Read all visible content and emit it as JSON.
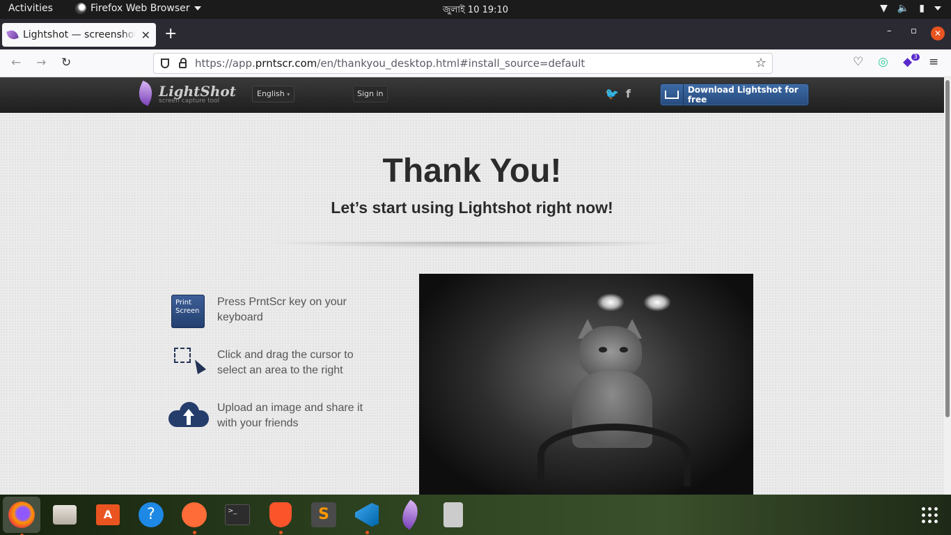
{
  "system_bar": {
    "activities": "Activities",
    "app_name": "Firefox Web Browser",
    "clock": "জুলাই 10  19:10"
  },
  "browser": {
    "tab_title": "Lightshot — screenshot tool",
    "new_tab": "+",
    "url_prefix": "https://app.",
    "url_host": "prntscr.com",
    "url_path": "/en/thankyou_desktop.html#install_source=default",
    "extension_badge": "3"
  },
  "site_header": {
    "brand_name": "LightShot",
    "brand_tagline": "screen capture tool",
    "language": "English",
    "sign_in": "Sign in",
    "download_button": "Download Lightshot for free"
  },
  "main": {
    "heading": "Thank You!",
    "subheading": "Let’s start using Lightshot right now!",
    "steps": [
      {
        "icon": "print-screen-key-icon",
        "key_line1": "Print",
        "key_line2": "Screen",
        "line1": "Press PrntScr key on your",
        "line2": "keyboard"
      },
      {
        "icon": "select-area-icon",
        "line1": "Click and drag the cursor to",
        "line2": "select an area to the right"
      },
      {
        "icon": "cloud-upload-icon",
        "line1": "Upload an image and share it",
        "line2": "with your friends"
      }
    ]
  },
  "colors": {
    "accent_orange": "#e95420",
    "download_blue": "#3c6aa5",
    "page_bg": "#ebebeb",
    "text_dark": "#2b2b2b"
  },
  "dock": [
    "firefox-icon",
    "files-icon",
    "software-icon",
    "help-icon",
    "postman-icon",
    "terminal-icon",
    "brave-icon",
    "sublime-icon",
    "vscode-icon",
    "lightshot-icon",
    "disk-icon"
  ]
}
